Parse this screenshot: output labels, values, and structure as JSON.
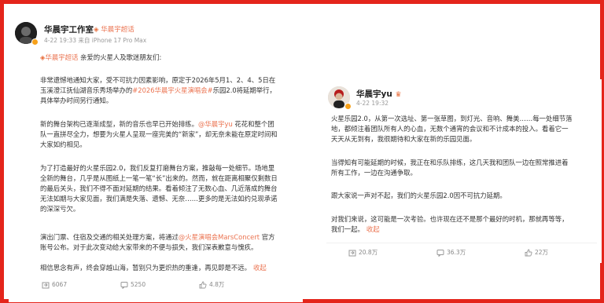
{
  "left_post": {
    "author": "华晨宇工作室",
    "super_topic": "华晨宇超话",
    "time": "4-22 19:33",
    "source": "来自 iPhone 17 Pro Max",
    "greeting_tag": "华晨宇超话",
    "greeting": " 亲爱的火星人及歌迷朋友们:",
    "p1_line1": "非常遗憾地通知大家，受不可抗力因素影响，原定于2026年5月1、2、4、5日在",
    "p1_line2_a": "玉溪澄江抚仙湖音乐秀场举办的",
    "p1_line2_topic": "#2026华晨宇火星演唱会#",
    "p1_line2_b": "乐园2.0将延期举行，",
    "p1_line3": "具体举办时间另行通知。",
    "p2_line1_a": "新的舞台架构已逐渐成型，新的音乐也早已开始排练。",
    "p2_line1_mention": "@华晨宇yu",
    "p2_line1_b": " 花花和整个团",
    "p2_line2": "队一直拼尽全力，想要为火星人呈现一座完美的“新家”，却无奈未能在原定时间和",
    "p2_line3": "大家如约相见。",
    "p3_line1": "为了打造最好的火星乐园2.0，我们反复打磨舞台方案，推敲每一处细节。场地里",
    "p3_line2": "全新的舞台，几乎是从图纸上一笔一笔“长”出来的。然而，就在距离相聚仅剩数日",
    "p3_line3": "的最后关头，我们不得不面对延期的结果。看着倾注了无数心血、几近落成的舞台",
    "p3_line4": "无法如期与大家见面，我们满是失落、遗憾、无奈……更多的是无法如约兑现承诺",
    "p3_line5": "的深深亏欠。",
    "p4_line1_a": "演出门票、住宿及交通的相关处理方案，将通过",
    "p4_line1_mention": "@火星演唱会MarsConcert",
    "p4_line1_b": " 官方",
    "p4_line2": "账号公布。对于此次变动给大家带来的不便与损失，我们深表歉意与愧疚。",
    "p5_line1": "相信思念有声，终会穿越山海，暂别只为更炽热的重逢，再见即是不远。",
    "collapse": "收起",
    "repost_count": "6067",
    "comment_count": "5250",
    "like_count": "4.8万"
  },
  "right_post": {
    "author": "华晨宇yu",
    "time": "4-22 19:32",
    "p1_line1": "火星乐园2.0，从第一次选址、第一张草图，到灯光、音响、舞美……每一处细节落",
    "p1_line2": "地，都倾注着团队所有人的心血，无数个通宵的会议和不计成本的投入。看着它一",
    "p1_line3": "天天从无到有，我很期待和大家在新的乐园见面。",
    "p2_line1": "当得知有可能延期的时候，我正在和乐队排练，这几天我和团队一边在照常推进着",
    "p2_line2": "所有工作，一边在沟通争取。",
    "p3_line1": "跟大家说一声对不起，我们的火星乐园2.0因不可抗力延期。",
    "p4_line1": "对我们来说，这可能是一次考验。也许现在还不是那个最好的时机，那就再等等，",
    "p4_line2": "我们一起。",
    "collapse": "收起",
    "repost_count": "20.8万",
    "comment_count": "36.3万",
    "like_count": "22万"
  },
  "colors": {
    "frame": "#e4251b",
    "link": "#eb7350",
    "text": "#333333",
    "meta": "#999999"
  }
}
